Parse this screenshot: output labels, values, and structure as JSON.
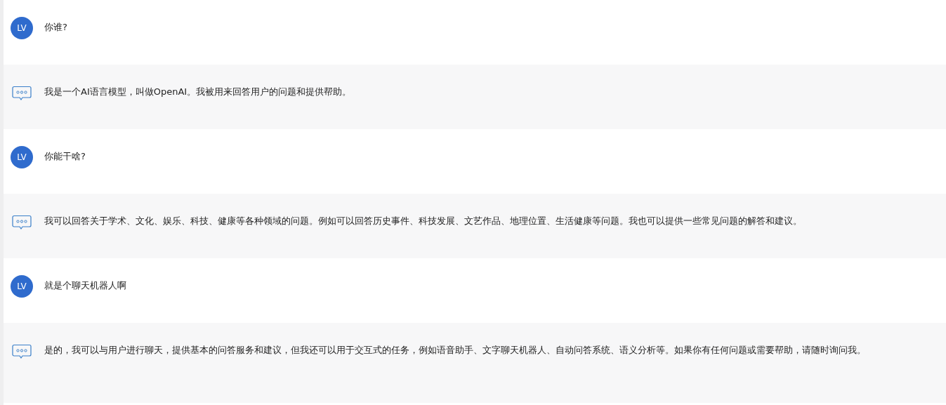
{
  "messages": [
    {
      "kind": "user",
      "avatar": "LV",
      "text": "你谁?"
    },
    {
      "kind": "bot",
      "text": "我是一个AI语言模型，叫做OpenAI。我被用来回答用户的问题和提供帮助。"
    },
    {
      "kind": "user",
      "avatar": "LV",
      "text": "你能干啥?"
    },
    {
      "kind": "bot",
      "text": "我可以回答关于学术、文化、娱乐、科技、健康等各种领域的问题。例如可以回答历史事件、科技发展、文艺作品、地理位置、生活健康等问题。我也可以提供一些常见问题的解答和建议。"
    },
    {
      "kind": "user",
      "avatar": "LV",
      "text": "就是个聊天机器人啊"
    },
    {
      "kind": "bot",
      "text": "是的，我可以与用户进行聊天，提供基本的问答服务和建议，但我还可以用于交互式的任务，例如语音助手、文字聊天机器人、自动问答系统、语义分析等。如果你有任何问题或需要帮助，请随时询问我。"
    }
  ]
}
